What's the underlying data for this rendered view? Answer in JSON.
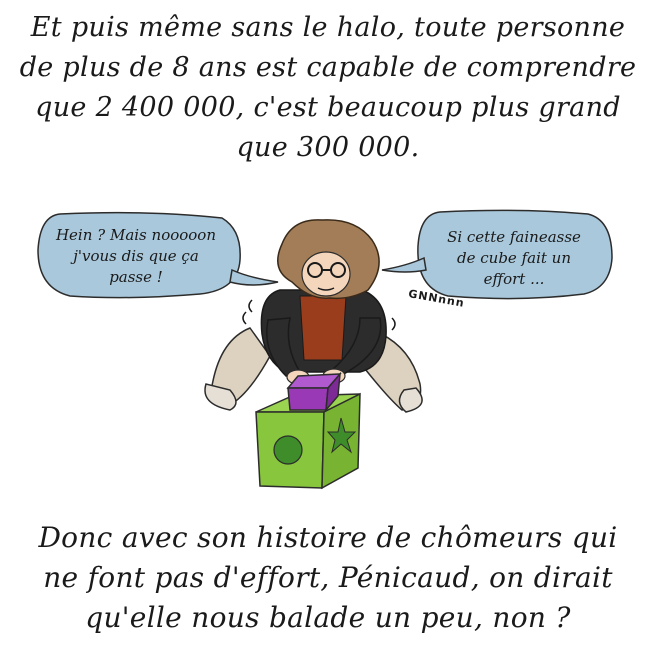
{
  "caption_top": {
    "lines": [
      "Et puis même sans le halo, toute personne",
      "de plus de 8 ans est capable de comprendre",
      "que 2 400 000, c'est beaucoup plus grand",
      "que 300 000."
    ]
  },
  "bubble_left": {
    "lines": [
      "Hein ? Mais nooooon",
      "j'vous dis que ça",
      "passe !"
    ]
  },
  "bubble_right": {
    "lines": [
      "Si cette faineasse",
      "de cube fait un",
      "effort ..."
    ]
  },
  "sound_effect": "GNNnnn",
  "caption_bottom": {
    "lines": [
      "Donc avec son histoire de chômeurs qui",
      "ne font pas d'effort, Pénicaud, on dirait",
      "qu'elle nous balade un peu, non ?"
    ]
  },
  "colors": {
    "bubble": "#a9c8db",
    "hair": "#a27d57",
    "skin": "#f4d6bd",
    "jacket": "#2c2c2c",
    "shirt": "#9a3d1d",
    "pants": "#ddd2bf",
    "purple_cube": "#9939b6",
    "green_cube": "#87c63d",
    "green_mark": "#3f8c2a"
  }
}
